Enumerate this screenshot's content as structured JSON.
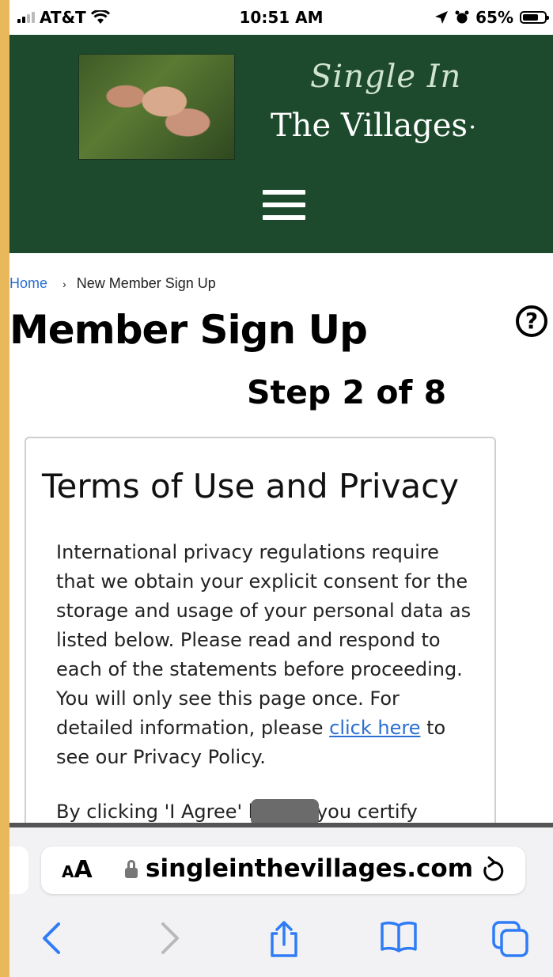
{
  "status_bar": {
    "carrier": "AT&T",
    "time": "10:51 AM",
    "battery": "65%",
    "battery_level": 0.65,
    "icons": [
      "signal-icon",
      "wifi-icon",
      "location-icon",
      "alarm-icon",
      "battery-icon"
    ]
  },
  "header": {
    "brand_line1": "Single In",
    "brand_line2": "The Villages",
    "brand_mark": "•",
    "menu_icon": "hamburger-menu-icon",
    "bg_color": "#1d4a2c"
  },
  "breadcrumb": {
    "home": "Home",
    "separator": "›",
    "current": "New Member Sign Up"
  },
  "page": {
    "title": "Member Sign Up",
    "step": "Step 2 of 8",
    "help": "?"
  },
  "terms": {
    "title": "Terms of Use and Privacy",
    "body_before_link": "International privacy regulations require that we obtain your explicit consent for the storage and usage of your personal data as listed below. Please read and respond to each of the statements before proceeding. You will only see this page once. For detailed information, please ",
    "link_text": "click here",
    "body_after_link": " to see our Privacy Policy.",
    "body2_partial": "By clicking 'I Agree' below, you certify"
  },
  "browser": {
    "aa_small": "A",
    "aa_large": "A",
    "domain": "singleinthevillages.com",
    "accent": "#2f7cf6"
  }
}
